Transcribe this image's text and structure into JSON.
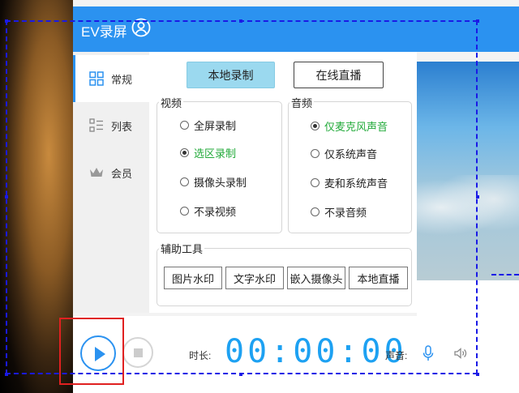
{
  "app": {
    "title": "EV录屏"
  },
  "sidebar": {
    "items": [
      {
        "label": "常规",
        "icon": "grid-icon",
        "active": true
      },
      {
        "label": "列表",
        "icon": "list-icon",
        "active": false
      },
      {
        "label": "会员",
        "icon": "crown-icon",
        "active": false
      }
    ]
  },
  "modes": {
    "local_label": "本地录制",
    "live_label": "在线直播"
  },
  "video": {
    "title": "视频",
    "options": [
      "全屏录制",
      "选区录制",
      "摄像头录制",
      "不录视频"
    ],
    "selected": "选区录制"
  },
  "audio": {
    "title": "音频",
    "options": [
      "仅麦克风声音",
      "仅系统声音",
      "麦和系统声音",
      "不录音频"
    ],
    "selected": "仅麦克风声音"
  },
  "tools": {
    "title": "辅助工具",
    "buttons": [
      "图片水印",
      "文字水印",
      "嵌入摄像头",
      "本地直播"
    ]
  },
  "bottom": {
    "time_label": "时长:",
    "time_value": "00:00:00",
    "volume_label": "声音:"
  },
  "colors": {
    "accent": "#2b92f0",
    "selected_text": "#22aa3a",
    "local_button_bg": "#9bd9ef",
    "selection_dashes": "#1a1ae6",
    "highlight_box": "#e02020",
    "timer": "#1da1f2"
  }
}
